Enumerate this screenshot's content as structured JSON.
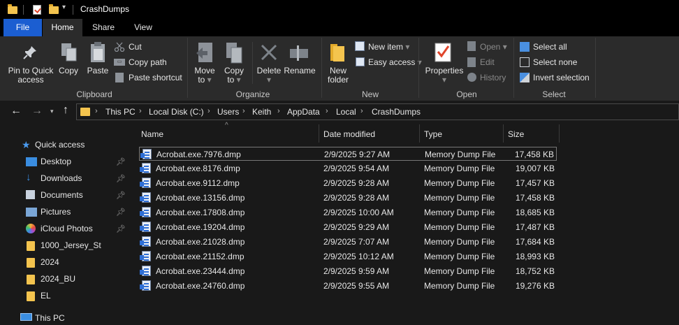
{
  "window": {
    "title": "CrashDumps"
  },
  "tabs": [
    {
      "label": "File"
    },
    {
      "label": "Home"
    },
    {
      "label": "Share"
    },
    {
      "label": "View"
    }
  ],
  "ribbon": {
    "clipboard": {
      "group_label": "Clipboard",
      "pin_label_1": "Pin to Quick",
      "pin_label_2": "access",
      "copy": "Copy",
      "paste": "Paste",
      "cut": "Cut",
      "copy_path": "Copy path",
      "paste_shortcut": "Paste shortcut"
    },
    "organize": {
      "group_label": "Organize",
      "move_to_1": "Move",
      "move_to_2": "to",
      "copy_to_1": "Copy",
      "copy_to_2": "to",
      "delete": "Delete",
      "rename": "Rename"
    },
    "new": {
      "group_label": "New",
      "new_folder_1": "New",
      "new_folder_2": "folder",
      "new_item": "New item",
      "easy_access": "Easy access"
    },
    "open": {
      "group_label": "Open",
      "properties": "Properties",
      "open": "Open",
      "edit": "Edit",
      "history": "History"
    },
    "select": {
      "group_label": "Select",
      "select_all": "Select all",
      "select_none": "Select none",
      "invert_selection": "Invert selection"
    }
  },
  "address": {
    "crumbs": [
      "This PC",
      "Local Disk (C:)",
      "Users",
      "Keith",
      "AppData",
      "Local",
      "CrashDumps"
    ]
  },
  "nav": {
    "quick_access": "Quick access",
    "items": [
      {
        "label": "Desktop",
        "icon": "desktop-icon",
        "pinned": true
      },
      {
        "label": "Downloads",
        "icon": "download-icon",
        "pinned": true
      },
      {
        "label": "Documents",
        "icon": "documents-icon",
        "pinned": true
      },
      {
        "label": "Pictures",
        "icon": "pictures-icon",
        "pinned": true
      },
      {
        "label": "iCloud Photos",
        "icon": "icloud-photos-icon",
        "pinned": true
      },
      {
        "label": "1000_Jersey_St",
        "icon": "folder-icon",
        "pinned": false
      },
      {
        "label": "2024",
        "icon": "folder-icon",
        "pinned": false
      },
      {
        "label": "2024_BU",
        "icon": "folder-icon",
        "pinned": false
      },
      {
        "label": "EL",
        "icon": "folder-icon",
        "pinned": false
      }
    ],
    "this_pc": "This PC"
  },
  "columns": {
    "name": "Name",
    "date": "Date modified",
    "type": "Type",
    "size": "Size"
  },
  "files": [
    {
      "name": "Acrobat.exe.7976.dmp",
      "date": "2/9/2025 9:27 AM",
      "type": "Memory Dump File",
      "size": "17,458 KB"
    },
    {
      "name": "Acrobat.exe.8176.dmp",
      "date": "2/9/2025 9:54 AM",
      "type": "Memory Dump File",
      "size": "19,007 KB"
    },
    {
      "name": "Acrobat.exe.9112.dmp",
      "date": "2/9/2025 9:28 AM",
      "type": "Memory Dump File",
      "size": "17,457 KB"
    },
    {
      "name": "Acrobat.exe.13156.dmp",
      "date": "2/9/2025 9:28 AM",
      "type": "Memory Dump File",
      "size": "17,458 KB"
    },
    {
      "name": "Acrobat.exe.17808.dmp",
      "date": "2/9/2025 10:00 AM",
      "type": "Memory Dump File",
      "size": "18,685 KB"
    },
    {
      "name": "Acrobat.exe.19204.dmp",
      "date": "2/9/2025 9:29 AM",
      "type": "Memory Dump File",
      "size": "17,487 KB"
    },
    {
      "name": "Acrobat.exe.21028.dmp",
      "date": "2/9/2025 7:07 AM",
      "type": "Memory Dump File",
      "size": "17,684 KB"
    },
    {
      "name": "Acrobat.exe.21152.dmp",
      "date": "2/9/2025 10:12 AM",
      "type": "Memory Dump File",
      "size": "18,993 KB"
    },
    {
      "name": "Acrobat.exe.23444.dmp",
      "date": "2/9/2025 9:59 AM",
      "type": "Memory Dump File",
      "size": "18,752 KB"
    },
    {
      "name": "Acrobat.exe.24760.dmp",
      "date": "2/9/2025 9:55 AM",
      "type": "Memory Dump File",
      "size": "19,276 KB"
    }
  ],
  "colors": {
    "accent": "#1b5ed1",
    "folder": "#f4c44e",
    "background": "#191919",
    "ribbon": "#2b2b2b"
  }
}
